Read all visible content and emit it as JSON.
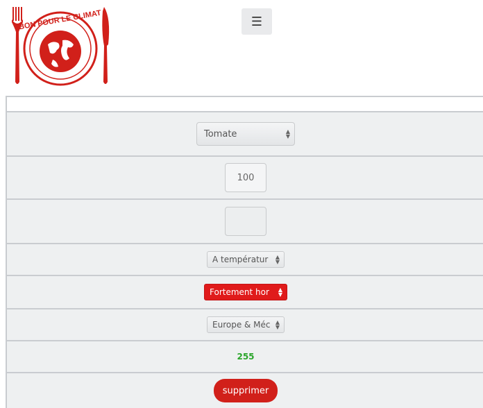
{
  "header": {
    "logo_text": "BON POUR LE CLIMAT",
    "menu_icon": "hamburger-icon"
  },
  "form": {
    "ingredient_select": "Tomate",
    "quantity_value": "100",
    "empty_field_value": "",
    "conservation_select": "A températur",
    "season_select": "Fortement hor",
    "origin_select": "Europe & Méc",
    "score_value": "255",
    "delete_button": "supprimer"
  },
  "colors": {
    "brand_red": "#d1201a",
    "score_green": "#2aa52a",
    "row_bg": "#eef0f1"
  }
}
